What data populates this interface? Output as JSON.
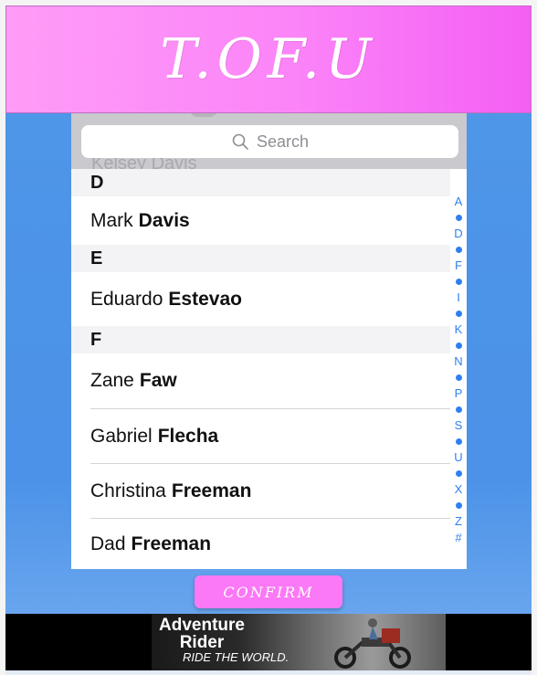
{
  "header": {
    "title": "T.OF.U"
  },
  "search": {
    "placeholder": "Search",
    "ghost_text": "Kelsey Davis",
    "icon": "search-icon"
  },
  "contacts": {
    "sections": [
      {
        "letter": "D",
        "rows": [
          {
            "first": "Mark",
            "last": "Davis"
          }
        ]
      },
      {
        "letter": "E",
        "rows": [
          {
            "first": "Eduardo",
            "last": "Estevao"
          }
        ]
      },
      {
        "letter": "F",
        "rows": [
          {
            "first": "Zane",
            "last": "Faw"
          },
          {
            "first": "Gabriel",
            "last": "Flecha"
          },
          {
            "first": "Christina",
            "last": "Freeman"
          },
          {
            "first": "Dad",
            "last": "Freeman"
          }
        ]
      }
    ]
  },
  "index": {
    "letters": [
      "A",
      "D",
      "F",
      "I",
      "K",
      "N",
      "P",
      "S",
      "U",
      "X",
      "Z",
      "#"
    ],
    "color": "#2f7ff0"
  },
  "confirm": {
    "label": "CONFIRM"
  },
  "ad": {
    "brand_line1": "Adventure",
    "brand_line2": "Rider",
    "tagline": "RIDE THE WORLD."
  },
  "colors": {
    "header_pink": "#fb84f8",
    "background_blue": "#4f97e8",
    "accent_blue": "#2f7ff0",
    "button_pink": "#fb78f6"
  }
}
